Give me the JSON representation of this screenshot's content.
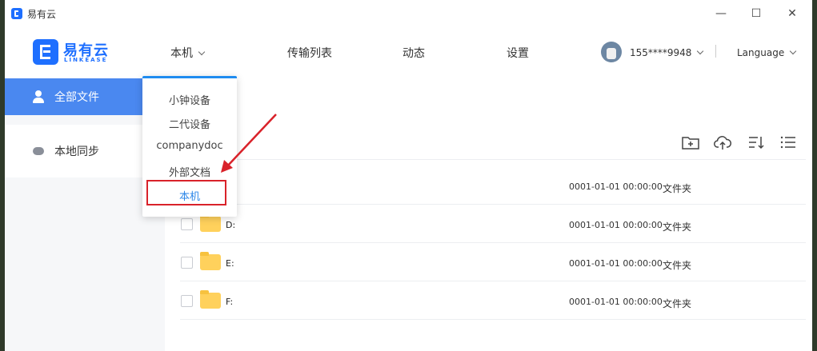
{
  "window": {
    "title": "易有云",
    "controls": [
      "—",
      "☐",
      "✕"
    ]
  },
  "logo": {
    "cn": "易有云",
    "en": "LINKEASE"
  },
  "nav": {
    "local": "本机",
    "transfer": "传输列表",
    "activity": "动态",
    "settings": "设置"
  },
  "user": {
    "phone": "155****9948",
    "language": "Language"
  },
  "sidebar": {
    "items": [
      {
        "label": "全部文件"
      },
      {
        "label": "本地同步"
      }
    ]
  },
  "dropdown": {
    "items": [
      "小钟设备",
      "二代设备",
      "companydoc",
      "外部文档",
      "本机"
    ],
    "selected": "本机"
  },
  "files": [
    {
      "name": "",
      "date": "0001-01-01 00:00:00",
      "type": "文件夹"
    },
    {
      "name": "D:",
      "date": "0001-01-01 00:00:00",
      "type": "文件夹"
    },
    {
      "name": "E:",
      "date": "0001-01-01 00:00:00",
      "type": "文件夹"
    },
    {
      "name": "F:",
      "date": "0001-01-01 00:00:00",
      "type": "文件夹"
    }
  ],
  "toolbar": {
    "icons": [
      "new-folder-icon",
      "upload-icon",
      "sort-icon",
      "list-view-icon"
    ]
  },
  "colors": {
    "accent": "#1e6fff",
    "sidebar_active": "#4a88f0",
    "dropdown_top": "#1f8cf0",
    "annotation": "#d9222a"
  }
}
